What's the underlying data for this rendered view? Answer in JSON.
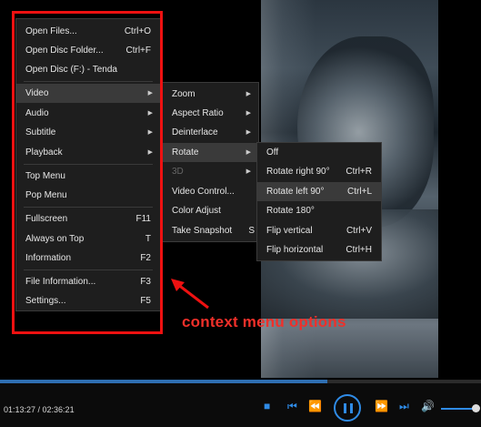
{
  "main_menu": {
    "items": [
      {
        "label": "Open Files...",
        "shortcut": "Ctrl+O"
      },
      {
        "label": "Open Disc Folder...",
        "shortcut": "Ctrl+F"
      },
      {
        "label": "Open Disc (F:) - Tenda",
        "shortcut": ""
      },
      {
        "label": "Video",
        "shortcut": ""
      },
      {
        "label": "Audio",
        "shortcut": ""
      },
      {
        "label": "Subtitle",
        "shortcut": ""
      },
      {
        "label": "Playback",
        "shortcut": ""
      },
      {
        "label": "Top Menu",
        "shortcut": ""
      },
      {
        "label": "Pop Menu",
        "shortcut": ""
      },
      {
        "label": "Fullscreen",
        "shortcut": "F11"
      },
      {
        "label": "Always on Top",
        "shortcut": "T"
      },
      {
        "label": "Information",
        "shortcut": "F2"
      },
      {
        "label": "File Information...",
        "shortcut": "F3"
      },
      {
        "label": "Settings...",
        "shortcut": "F5"
      }
    ]
  },
  "video_submenu": {
    "items": [
      {
        "label": "Zoom",
        "shortcut": ""
      },
      {
        "label": "Aspect Ratio",
        "shortcut": ""
      },
      {
        "label": "Deinterlace",
        "shortcut": ""
      },
      {
        "label": "Rotate",
        "shortcut": ""
      },
      {
        "label": "3D",
        "shortcut": ""
      },
      {
        "label": "Video Control...",
        "shortcut": ""
      },
      {
        "label": "Color Adjust",
        "shortcut": ""
      },
      {
        "label": "Take Snapshot",
        "shortcut": "S"
      }
    ]
  },
  "rotate_submenu": {
    "items": [
      {
        "label": "Off",
        "shortcut": ""
      },
      {
        "label": "Rotate right 90°",
        "shortcut": "Ctrl+R"
      },
      {
        "label": "Rotate left 90°",
        "shortcut": "Ctrl+L"
      },
      {
        "label": "Rotate 180°",
        "shortcut": ""
      },
      {
        "label": "Flip vertical",
        "shortcut": "Ctrl+V"
      },
      {
        "label": "Flip horizontal",
        "shortcut": "Ctrl+H"
      }
    ]
  },
  "annotation": {
    "text": "context menu options"
  },
  "player": {
    "time": "01:13:27 / 02:36:21",
    "progress": 0.68,
    "volume": 1.0,
    "icons": [
      "stop-icon",
      "prev-icon",
      "rewind-icon",
      "pause-icon",
      "forward-icon",
      "next-icon",
      "volume-icon"
    ]
  },
  "colors": {
    "accent": "#2f8be6",
    "annotation": "#ee1111",
    "menu_bg": "#1e1e1e"
  }
}
